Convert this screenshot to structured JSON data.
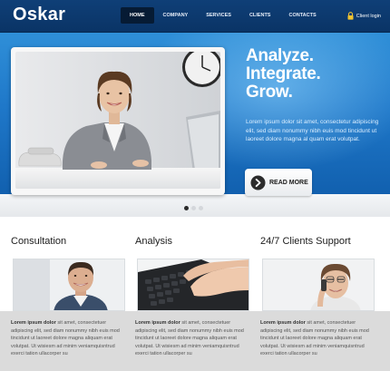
{
  "header": {
    "logo": "Oskar",
    "nav": [
      "HOME",
      "COMPANY",
      "SERVICES",
      "CLIENTS",
      "CONTACTS"
    ],
    "active_nav": "HOME",
    "login_label": "Client login",
    "lock_icon": "lock-icon"
  },
  "hero": {
    "headline": [
      "Analyze.",
      "Integrate.",
      "Grow."
    ],
    "text": "Lorem ipsum dolor sit amet, consectetur adipiscing elit, sed diam nonummy nibh euis mod tincidunt ut laoreet dolore magna al quam erat volutpat.",
    "read_more_label": "READ MORE",
    "arrow_icon": "arrow-right-circle-icon",
    "slider_dots": 3,
    "active_slide": 1,
    "accent_color": "#1f78c9"
  },
  "features": [
    {
      "title": "Consultation",
      "lead": "Lorem ipsum dolor",
      "text": " sit amet, consectetuer adipiscing elit, sed diam nonummy nibh euis mod tincidunt ut laoreet dolore magna aliquam erat volutpat. Ut wisiesm ad minim veniamquisntrud exerci tation ullacorper su"
    },
    {
      "title": "Analysis",
      "lead": "Lorem ipsum dolor",
      "text": " sit amet, consectetuer adipiscing elit, sed diam nonummy nibh euis mod tincidunt ut laoreet dolore magna aliquam erat volutpat. Ut wisiesm ad minim veniamquisntrud exerci tation ullacorper su"
    },
    {
      "title": "24/7 Clients Support",
      "lead": "Lorem ipsum dolor",
      "text": " sit amet, consectetuer adipiscing elit, sed diam nonummy nibh euis mod tincidunt ut laoreet dolore magna aliquam erat volutpat. Ut wisiesm ad minim veniamquisntrud exerci tation ullacorper su"
    }
  ]
}
